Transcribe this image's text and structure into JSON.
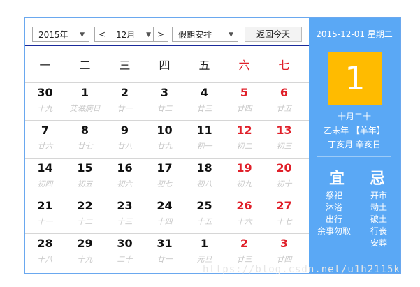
{
  "toolbar": {
    "year_label": "2015年",
    "month_label": "12月",
    "prev_label": "<",
    "next_label": ">",
    "holiday_label": "假期安排",
    "today_label": "返回今天",
    "dropdown_arrow": "▼"
  },
  "weekdays": [
    "一",
    "二",
    "三",
    "四",
    "五",
    "六",
    "七"
  ],
  "weeks": [
    [
      {
        "d": "30",
        "l": "十九"
      },
      {
        "d": "1",
        "l": "艾滋病日"
      },
      {
        "d": "2",
        "l": "廿一"
      },
      {
        "d": "3",
        "l": "廿二"
      },
      {
        "d": "4",
        "l": "廿三"
      },
      {
        "d": "5",
        "l": "廿四"
      },
      {
        "d": "6",
        "l": "廿五"
      }
    ],
    [
      {
        "d": "7",
        "l": "廿六"
      },
      {
        "d": "8",
        "l": "廿七"
      },
      {
        "d": "9",
        "l": "廿八"
      },
      {
        "d": "10",
        "l": "廿九"
      },
      {
        "d": "11",
        "l": "初一"
      },
      {
        "d": "12",
        "l": "初二"
      },
      {
        "d": "13",
        "l": "初三"
      }
    ],
    [
      {
        "d": "14",
        "l": "初四"
      },
      {
        "d": "15",
        "l": "初五"
      },
      {
        "d": "16",
        "l": "初六"
      },
      {
        "d": "17",
        "l": "初七"
      },
      {
        "d": "18",
        "l": "初八"
      },
      {
        "d": "19",
        "l": "初九"
      },
      {
        "d": "20",
        "l": "初十"
      }
    ],
    [
      {
        "d": "21",
        "l": "十一"
      },
      {
        "d": "22",
        "l": "十二"
      },
      {
        "d": "23",
        "l": "十三"
      },
      {
        "d": "24",
        "l": "十四"
      },
      {
        "d": "25",
        "l": "十五"
      },
      {
        "d": "26",
        "l": "十六"
      },
      {
        "d": "27",
        "l": "十七"
      }
    ],
    [
      {
        "d": "28",
        "l": "十八"
      },
      {
        "d": "29",
        "l": "十九"
      },
      {
        "d": "30",
        "l": "二十"
      },
      {
        "d": "31",
        "l": "廿一"
      },
      {
        "d": "1",
        "l": "元旦"
      },
      {
        "d": "2",
        "l": "廿三"
      },
      {
        "d": "3",
        "l": "廿四"
      }
    ]
  ],
  "side": {
    "date_line": "2015-12-01 星期二",
    "big_day": "1",
    "lunar_date": "十月二十",
    "year_line": "乙未年 【羊年】",
    "ganzhi_line": "丁亥月 辛亥日",
    "yi_title": "宜",
    "ji_title": "忌",
    "yi_items": [
      "祭祀",
      "沐浴",
      "出行",
      "余事勿取"
    ],
    "ji_items": [
      "开市",
      "动土",
      "破土",
      "行丧",
      "安葬"
    ]
  },
  "watermark": "https://blog.csdn.net/u1h2115k",
  "colors": {
    "accent_blue": "#5aa8f5",
    "frame_blue": "#6aa8ef",
    "weekend_red": "#e0202a",
    "today_yellow": "#ffbb00",
    "header_line": "#1a2a9a"
  }
}
